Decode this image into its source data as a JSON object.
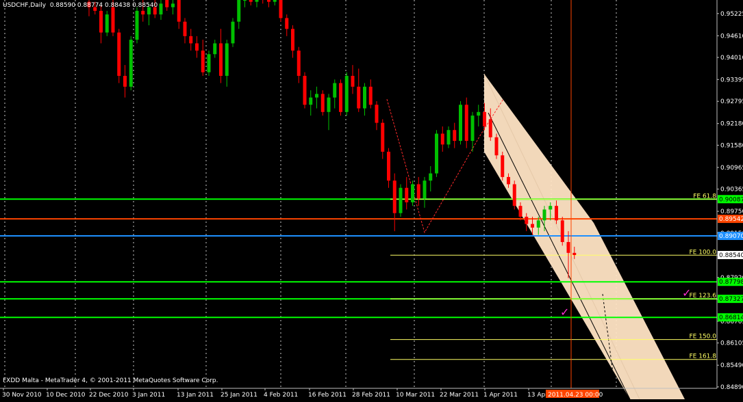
{
  "header": {
    "symbol_tf": "USDCHF,Daily",
    "ohlc": "0.88590 0.88774 0.88438 0.88540"
  },
  "footer": {
    "copyright": "FXDD Malta - MetaTrader 4, © 2001-2011 MetaQuotes Software Corp."
  },
  "colors": {
    "background": "#000000",
    "bull": "#00c000",
    "bear": "#ff0000",
    "grid": "#ffffff",
    "fib": "#ffff66",
    "green_line": "#00ff00",
    "orange_line": "#ff4500",
    "blue_line": "#1e90ff",
    "channel": "#ffe4c4",
    "cursor": "#ff4500",
    "check": "#ff2fd0"
  },
  "chart_data": {
    "type": "candlestick",
    "ylim": [
      0.8485,
      0.956
    ],
    "y_ticks": [
      "0.95225",
      "0.94610",
      "0.94010",
      "0.93399",
      "0.92795",
      "0.92180",
      "0.91580",
      "0.90965",
      "0.90365",
      "0.89750",
      "0.89150",
      "0.88535",
      "0.87920",
      "0.87320",
      "0.86705",
      "0.86105",
      "0.85490",
      "0.84890"
    ],
    "x_ticks": [
      "30 Nov 2010",
      "10 Dec 2010",
      "22 Dec 2010",
      "3 Jan 2011",
      "13 Jan 2011",
      "25 Jan 2011",
      "4 Feb 2011",
      "16 Feb 2011",
      "28 Feb 2011",
      "10 Mar 2011",
      "22 Mar 2011",
      "1 Apr 2011",
      "13 Apr 2011"
    ],
    "cursor_time": "2011.04.23 00:00",
    "price_tags": [
      {
        "value": 0.90087,
        "label": "0.90087",
        "bg": "#00ff00",
        "fg": "#000000"
      },
      {
        "value": 0.89542,
        "label": "0.89542",
        "bg": "#ff4500",
        "fg": "#ffffff"
      },
      {
        "value": 0.8907,
        "label": "0.89070",
        "bg": "#1e90ff",
        "fg": "#ffffff"
      },
      {
        "value": 0.8854,
        "label": "0.88540",
        "bg": "#ffffff",
        "fg": "#000000"
      },
      {
        "value": 0.87798,
        "label": "0.87798",
        "bg": "#00ff00",
        "fg": "#000000"
      },
      {
        "value": 0.87327,
        "label": "0.87327",
        "bg": "#00ff00",
        "fg": "#000000"
      },
      {
        "value": 0.86814,
        "label": "0.86814",
        "bg": "#00ff00",
        "fg": "#000000"
      }
    ],
    "horizontal_lines": [
      {
        "value": 0.90087,
        "color": "#00ff00",
        "full": true
      },
      {
        "value": 0.89542,
        "color": "#ff4500",
        "full": true
      },
      {
        "value": 0.8907,
        "color": "#1e90ff",
        "full": true
      },
      {
        "value": 0.87798,
        "color": "#00ff00",
        "full": true
      },
      {
        "value": 0.87327,
        "color": "#00ff00",
        "full": true
      },
      {
        "value": 0.86814,
        "color": "#00ff00",
        "full": true
      }
    ],
    "fib_levels": [
      {
        "label": "FE 61.8",
        "value": 0.90087
      },
      {
        "label": "FE 100.0",
        "value": 0.88535
      },
      {
        "label": "FE 123.6",
        "value": 0.87327
      },
      {
        "label": "FE 150.0",
        "value": 0.862
      },
      {
        "label": "FE 161.8",
        "value": 0.8565
      }
    ],
    "candles": [
      {
        "o": 0.9555,
        "h": 0.957,
        "l": 0.9515,
        "c": 0.954
      },
      {
        "o": 0.954,
        "h": 0.9555,
        "l": 0.952,
        "c": 0.953
      },
      {
        "o": 0.953,
        "h": 0.9545,
        "l": 0.944,
        "c": 0.947
      },
      {
        "o": 0.947,
        "h": 0.953,
        "l": 0.946,
        "c": 0.952
      },
      {
        "o": 0.954,
        "h": 0.956,
        "l": 0.946,
        "c": 0.947
      },
      {
        "o": 0.947,
        "h": 0.948,
        "l": 0.933,
        "c": 0.935
      },
      {
        "o": 0.935,
        "h": 0.938,
        "l": 0.929,
        "c": 0.932
      },
      {
        "o": 0.932,
        "h": 0.946,
        "l": 0.931,
        "c": 0.945
      },
      {
        "o": 0.945,
        "h": 0.954,
        "l": 0.944,
        "c": 0.953
      },
      {
        "o": 0.953,
        "h": 0.956,
        "l": 0.95,
        "c": 0.952
      },
      {
        "o": 0.952,
        "h": 0.955,
        "l": 0.949,
        "c": 0.954
      },
      {
        "o": 0.954,
        "h": 0.9565,
        "l": 0.951,
        "c": 0.952
      },
      {
        "o": 0.952,
        "h": 0.956,
        "l": 0.9505,
        "c": 0.955
      },
      {
        "o": 0.956,
        "h": 0.957,
        "l": 0.953,
        "c": 0.954
      },
      {
        "o": 0.954,
        "h": 0.956,
        "l": 0.952,
        "c": 0.955
      },
      {
        "o": 0.956,
        "h": 0.958,
        "l": 0.948,
        "c": 0.95
      },
      {
        "o": 0.95,
        "h": 0.951,
        "l": 0.944,
        "c": 0.946
      },
      {
        "o": 0.946,
        "h": 0.948,
        "l": 0.942,
        "c": 0.944
      },
      {
        "o": 0.944,
        "h": 0.946,
        "l": 0.94,
        "c": 0.942
      },
      {
        "o": 0.942,
        "h": 0.945,
        "l": 0.935,
        "c": 0.936
      },
      {
        "o": 0.936,
        "h": 0.942,
        "l": 0.935,
        "c": 0.941
      },
      {
        "o": 0.941,
        "h": 0.945,
        "l": 0.94,
        "c": 0.944
      },
      {
        "o": 0.944,
        "h": 0.948,
        "l": 0.933,
        "c": 0.935
      },
      {
        "o": 0.935,
        "h": 0.945,
        "l": 0.932,
        "c": 0.944
      },
      {
        "o": 0.944,
        "h": 0.951,
        "l": 0.943,
        "c": 0.95
      },
      {
        "o": 0.95,
        "h": 0.957,
        "l": 0.948,
        "c": 0.956
      },
      {
        "o": 0.956,
        "h": 0.9575,
        "l": 0.954,
        "c": 0.956
      },
      {
        "o": 0.956,
        "h": 0.9575,
        "l": 0.9545,
        "c": 0.9555
      },
      {
        "o": 0.9555,
        "h": 0.957,
        "l": 0.954,
        "c": 0.9565
      },
      {
        "o": 0.9565,
        "h": 0.9575,
        "l": 0.955,
        "c": 0.956
      },
      {
        "o": 0.956,
        "h": 0.957,
        "l": 0.954,
        "c": 0.9555
      },
      {
        "o": 0.9555,
        "h": 0.957,
        "l": 0.9545,
        "c": 0.9565
      },
      {
        "o": 0.9565,
        "h": 0.9575,
        "l": 0.95,
        "c": 0.951
      },
      {
        "o": 0.951,
        "h": 0.952,
        "l": 0.946,
        "c": 0.948
      },
      {
        "o": 0.948,
        "h": 0.949,
        "l": 0.94,
        "c": 0.942
      },
      {
        "o": 0.942,
        "h": 0.943,
        "l": 0.933,
        "c": 0.935
      },
      {
        "o": 0.935,
        "h": 0.936,
        "l": 0.926,
        "c": 0.927
      },
      {
        "o": 0.927,
        "h": 0.931,
        "l": 0.924,
        "c": 0.929
      },
      {
        "o": 0.929,
        "h": 0.932,
        "l": 0.926,
        "c": 0.93
      },
      {
        "o": 0.93,
        "h": 0.931,
        "l": 0.924,
        "c": 0.925
      },
      {
        "o": 0.925,
        "h": 0.93,
        "l": 0.92,
        "c": 0.929
      },
      {
        "o": 0.929,
        "h": 0.934,
        "l": 0.926,
        "c": 0.933
      },
      {
        "o": 0.933,
        "h": 0.934,
        "l": 0.924,
        "c": 0.925
      },
      {
        "o": 0.925,
        "h": 0.936,
        "l": 0.924,
        "c": 0.935
      },
      {
        "o": 0.935,
        "h": 0.938,
        "l": 0.93,
        "c": 0.932
      },
      {
        "o": 0.932,
        "h": 0.937,
        "l": 0.925,
        "c": 0.926
      },
      {
        "o": 0.926,
        "h": 0.933,
        "l": 0.924,
        "c": 0.932
      },
      {
        "o": 0.932,
        "h": 0.934,
        "l": 0.926,
        "c": 0.927
      },
      {
        "o": 0.927,
        "h": 0.928,
        "l": 0.92,
        "c": 0.922
      },
      {
        "o": 0.922,
        "h": 0.923,
        "l": 0.912,
        "c": 0.914
      },
      {
        "o": 0.914,
        "h": 0.915,
        "l": 0.904,
        "c": 0.906
      },
      {
        "o": 0.906,
        "h": 0.908,
        "l": 0.892,
        "c": 0.897
      },
      {
        "o": 0.897,
        "h": 0.905,
        "l": 0.896,
        "c": 0.904
      },
      {
        "o": 0.904,
        "h": 0.907,
        "l": 0.898,
        "c": 0.9
      },
      {
        "o": 0.9,
        "h": 0.906,
        "l": 0.899,
        "c": 0.905
      },
      {
        "o": 0.905,
        "h": 0.907,
        "l": 0.899,
        "c": 0.901
      },
      {
        "o": 0.901,
        "h": 0.907,
        "l": 0.8985,
        "c": 0.906
      },
      {
        "o": 0.906,
        "h": 0.91,
        "l": 0.903,
        "c": 0.908
      },
      {
        "o": 0.908,
        "h": 0.92,
        "l": 0.907,
        "c": 0.919
      },
      {
        "o": 0.919,
        "h": 0.921,
        "l": 0.914,
        "c": 0.916
      },
      {
        "o": 0.916,
        "h": 0.921,
        "l": 0.915,
        "c": 0.92
      },
      {
        "o": 0.92,
        "h": 0.922,
        "l": 0.915,
        "c": 0.917
      },
      {
        "o": 0.917,
        "h": 0.928,
        "l": 0.916,
        "c": 0.927
      },
      {
        "o": 0.927,
        "h": 0.929,
        "l": 0.915,
        "c": 0.917
      },
      {
        "o": 0.917,
        "h": 0.925,
        "l": 0.914,
        "c": 0.924
      },
      {
        "o": 0.924,
        "h": 0.927,
        "l": 0.921,
        "c": 0.925
      },
      {
        "o": 0.925,
        "h": 0.9275,
        "l": 0.92,
        "c": 0.921
      },
      {
        "o": 0.923,
        "h": 0.926,
        "l": 0.917,
        "c": 0.918
      },
      {
        "o": 0.918,
        "h": 0.919,
        "l": 0.912,
        "c": 0.913
      },
      {
        "o": 0.913,
        "h": 0.914,
        "l": 0.906,
        "c": 0.907
      },
      {
        "o": 0.907,
        "h": 0.908,
        "l": 0.904,
        "c": 0.905
      },
      {
        "o": 0.905,
        "h": 0.906,
        "l": 0.898,
        "c": 0.899
      },
      {
        "o": 0.899,
        "h": 0.9,
        "l": 0.895,
        "c": 0.896
      },
      {
        "o": 0.896,
        "h": 0.897,
        "l": 0.892,
        "c": 0.894
      },
      {
        "o": 0.894,
        "h": 0.896,
        "l": 0.891,
        "c": 0.893
      },
      {
        "o": 0.893,
        "h": 0.896,
        "l": 0.891,
        "c": 0.895
      },
      {
        "o": 0.895,
        "h": 0.899,
        "l": 0.892,
        "c": 0.898
      },
      {
        "o": 0.898,
        "h": 0.9,
        "l": 0.895,
        "c": 0.899
      },
      {
        "o": 0.899,
        "h": 0.9005,
        "l": 0.894,
        "c": 0.895
      },
      {
        "o": 0.895,
        "h": 0.896,
        "l": 0.888,
        "c": 0.889
      },
      {
        "o": 0.889,
        "h": 0.892,
        "l": 0.879,
        "c": 0.886
      },
      {
        "o": 0.886,
        "h": 0.8877,
        "l": 0.8843,
        "c": 0.8854
      }
    ]
  }
}
